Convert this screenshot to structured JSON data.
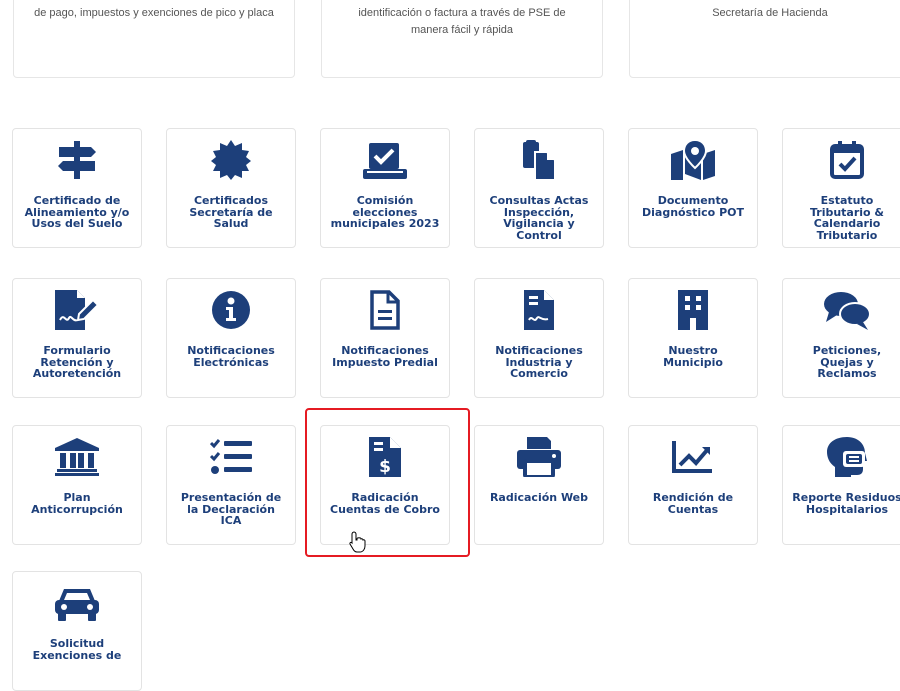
{
  "top_cards": [
    {
      "text": "de pago, impuestos y exenciones de pico y placa"
    },
    {
      "text": "identificación o factura a través de PSE de manera fácil y rápida"
    },
    {
      "text": "Secretaría de Hacienda"
    }
  ],
  "tiles": [
    {
      "label": "Certificado de Alineamiento y/o Usos del Suelo",
      "icon": "signpost-icon"
    },
    {
      "label": "Certificados Secretaría de Salud",
      "icon": "certificate-badge-icon"
    },
    {
      "label": "Comisión elecciones municipales 2023",
      "icon": "vote-box-icon"
    },
    {
      "label": "Consultas Actas Inspección, Vigilancia y Control",
      "icon": "clipboard-copy-icon"
    },
    {
      "label": "Documento Diagnóstico POT",
      "icon": "map-pin-icon"
    },
    {
      "label": "Estatuto Tributario & Calendario Tributario",
      "icon": "calendar-check-icon"
    },
    {
      "label": "Formulario Retención y Autoretención",
      "icon": "file-signature-icon"
    },
    {
      "label": "Notificaciones Electrónicas",
      "icon": "info-circle-icon"
    },
    {
      "label": "Notificaciones Impuesto Predial",
      "icon": "file-alt-icon"
    },
    {
      "label": "Notificaciones Industria y Comercio",
      "icon": "file-contract-icon"
    },
    {
      "label": "Nuestro Municipio",
      "icon": "building-icon"
    },
    {
      "label": "Peticiones, Quejas y Reclamos",
      "icon": "comments-icon"
    },
    {
      "label": "Plan Anticorrupción",
      "icon": "landmark-icon"
    },
    {
      "label": "Presentación de la Declaración ICA",
      "icon": "tasks-list-icon"
    },
    {
      "label": "Radicación Cuentas de Cobro",
      "icon": "file-invoice-dollar-icon"
    },
    {
      "label": "Radicación Web",
      "icon": "printer-icon"
    },
    {
      "label": "Rendición de Cuentas",
      "icon": "chart-line-icon"
    },
    {
      "label": "Reporte Residuos Hospitalarios",
      "icon": "head-mask-icon"
    },
    {
      "label": "Solicitud Exenciones de",
      "icon": "car-icon"
    }
  ],
  "colors": {
    "icon": "#1d3f7a",
    "label": "#1d3f7a",
    "highlight": "#e51b23"
  }
}
